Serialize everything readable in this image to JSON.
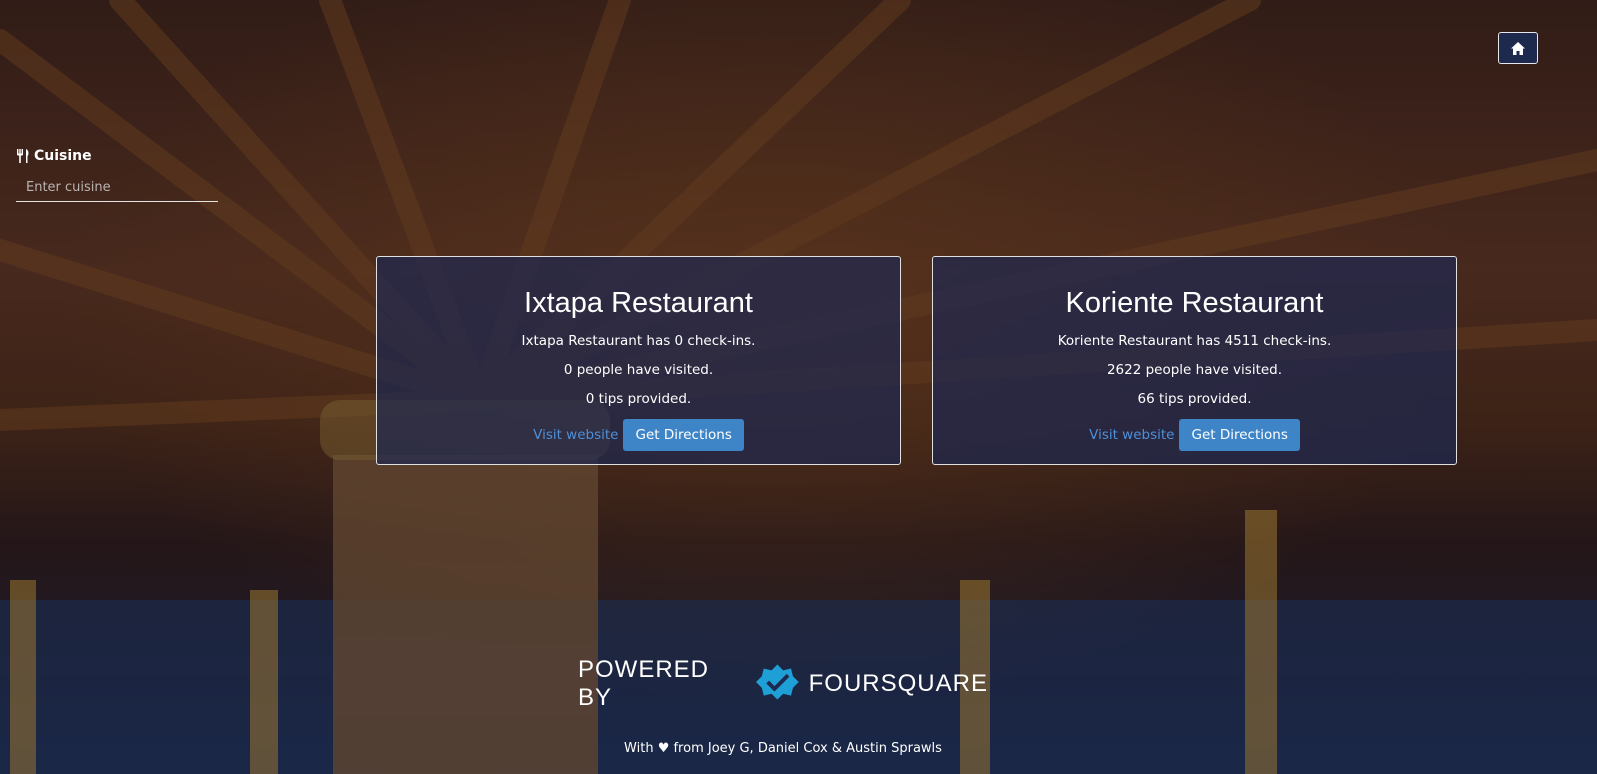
{
  "home": {
    "icon": "home-icon"
  },
  "search": {
    "label": "Cuisine",
    "label_icon": "utensils-icon",
    "placeholder": "Enter cuisine",
    "value": ""
  },
  "results": [
    {
      "name": "Ixtapa Restaurant",
      "checkins": "Ixtapa Restaurant has 0 check-ins.",
      "visitors": "0 people have visited.",
      "tips": "0 tips provided.",
      "website_label": "Visit website",
      "directions_label": "Get Directions"
    },
    {
      "name": "Koriente Restaurant",
      "checkins": "Koriente Restaurant has 4511 check-ins.",
      "visitors": "2622 people have visited.",
      "tips": "66 tips provided.",
      "website_label": "Visit website",
      "directions_label": "Get Directions"
    }
  ],
  "footer": {
    "powered_by": "POWERED BY",
    "brand": "FOURSQUARE",
    "credits": "With ♥ from Joey G, Daniel Cox & Austin Sprawls"
  },
  "colors": {
    "card_bg": "#1e2850",
    "button": "#3e85c8",
    "link": "#4f8fd6",
    "foursquare_logo": "#1e9fd6"
  }
}
